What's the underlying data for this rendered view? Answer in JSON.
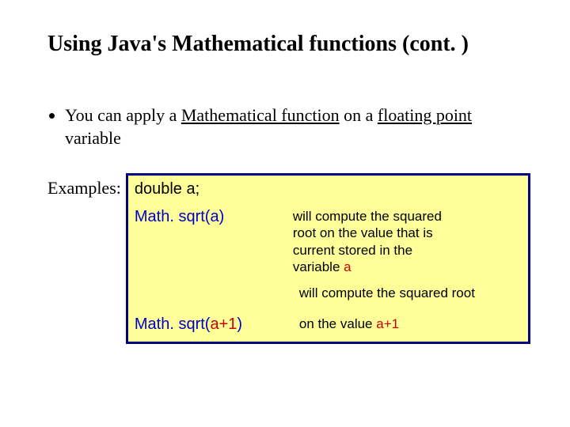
{
  "title": "Using Java's Mathematical functions (cont. )",
  "bullet": {
    "prefix": "You can apply a ",
    "u1": "Mathematical function",
    "mid": " on a ",
    "u2": "floating point",
    "suffix": " variable"
  },
  "examples_label": "Examples:",
  "code": {
    "decl": "double a;",
    "call1": "Math. sqrt(a)",
    "call2_prefix": "Math. sqrt(",
    "call2_arg": "a+1",
    "call2_suffix": ")",
    "desc1_line1": "will compute the squared",
    "desc1_line2": "root on the value that is",
    "desc1_line3": "current stored in the",
    "desc1_line4_prefix": "variable ",
    "desc1_line4_var": "a",
    "desc_mid": "will compute the squared root",
    "desc2_prefix": "on the value ",
    "desc2_arg": "a+1"
  }
}
